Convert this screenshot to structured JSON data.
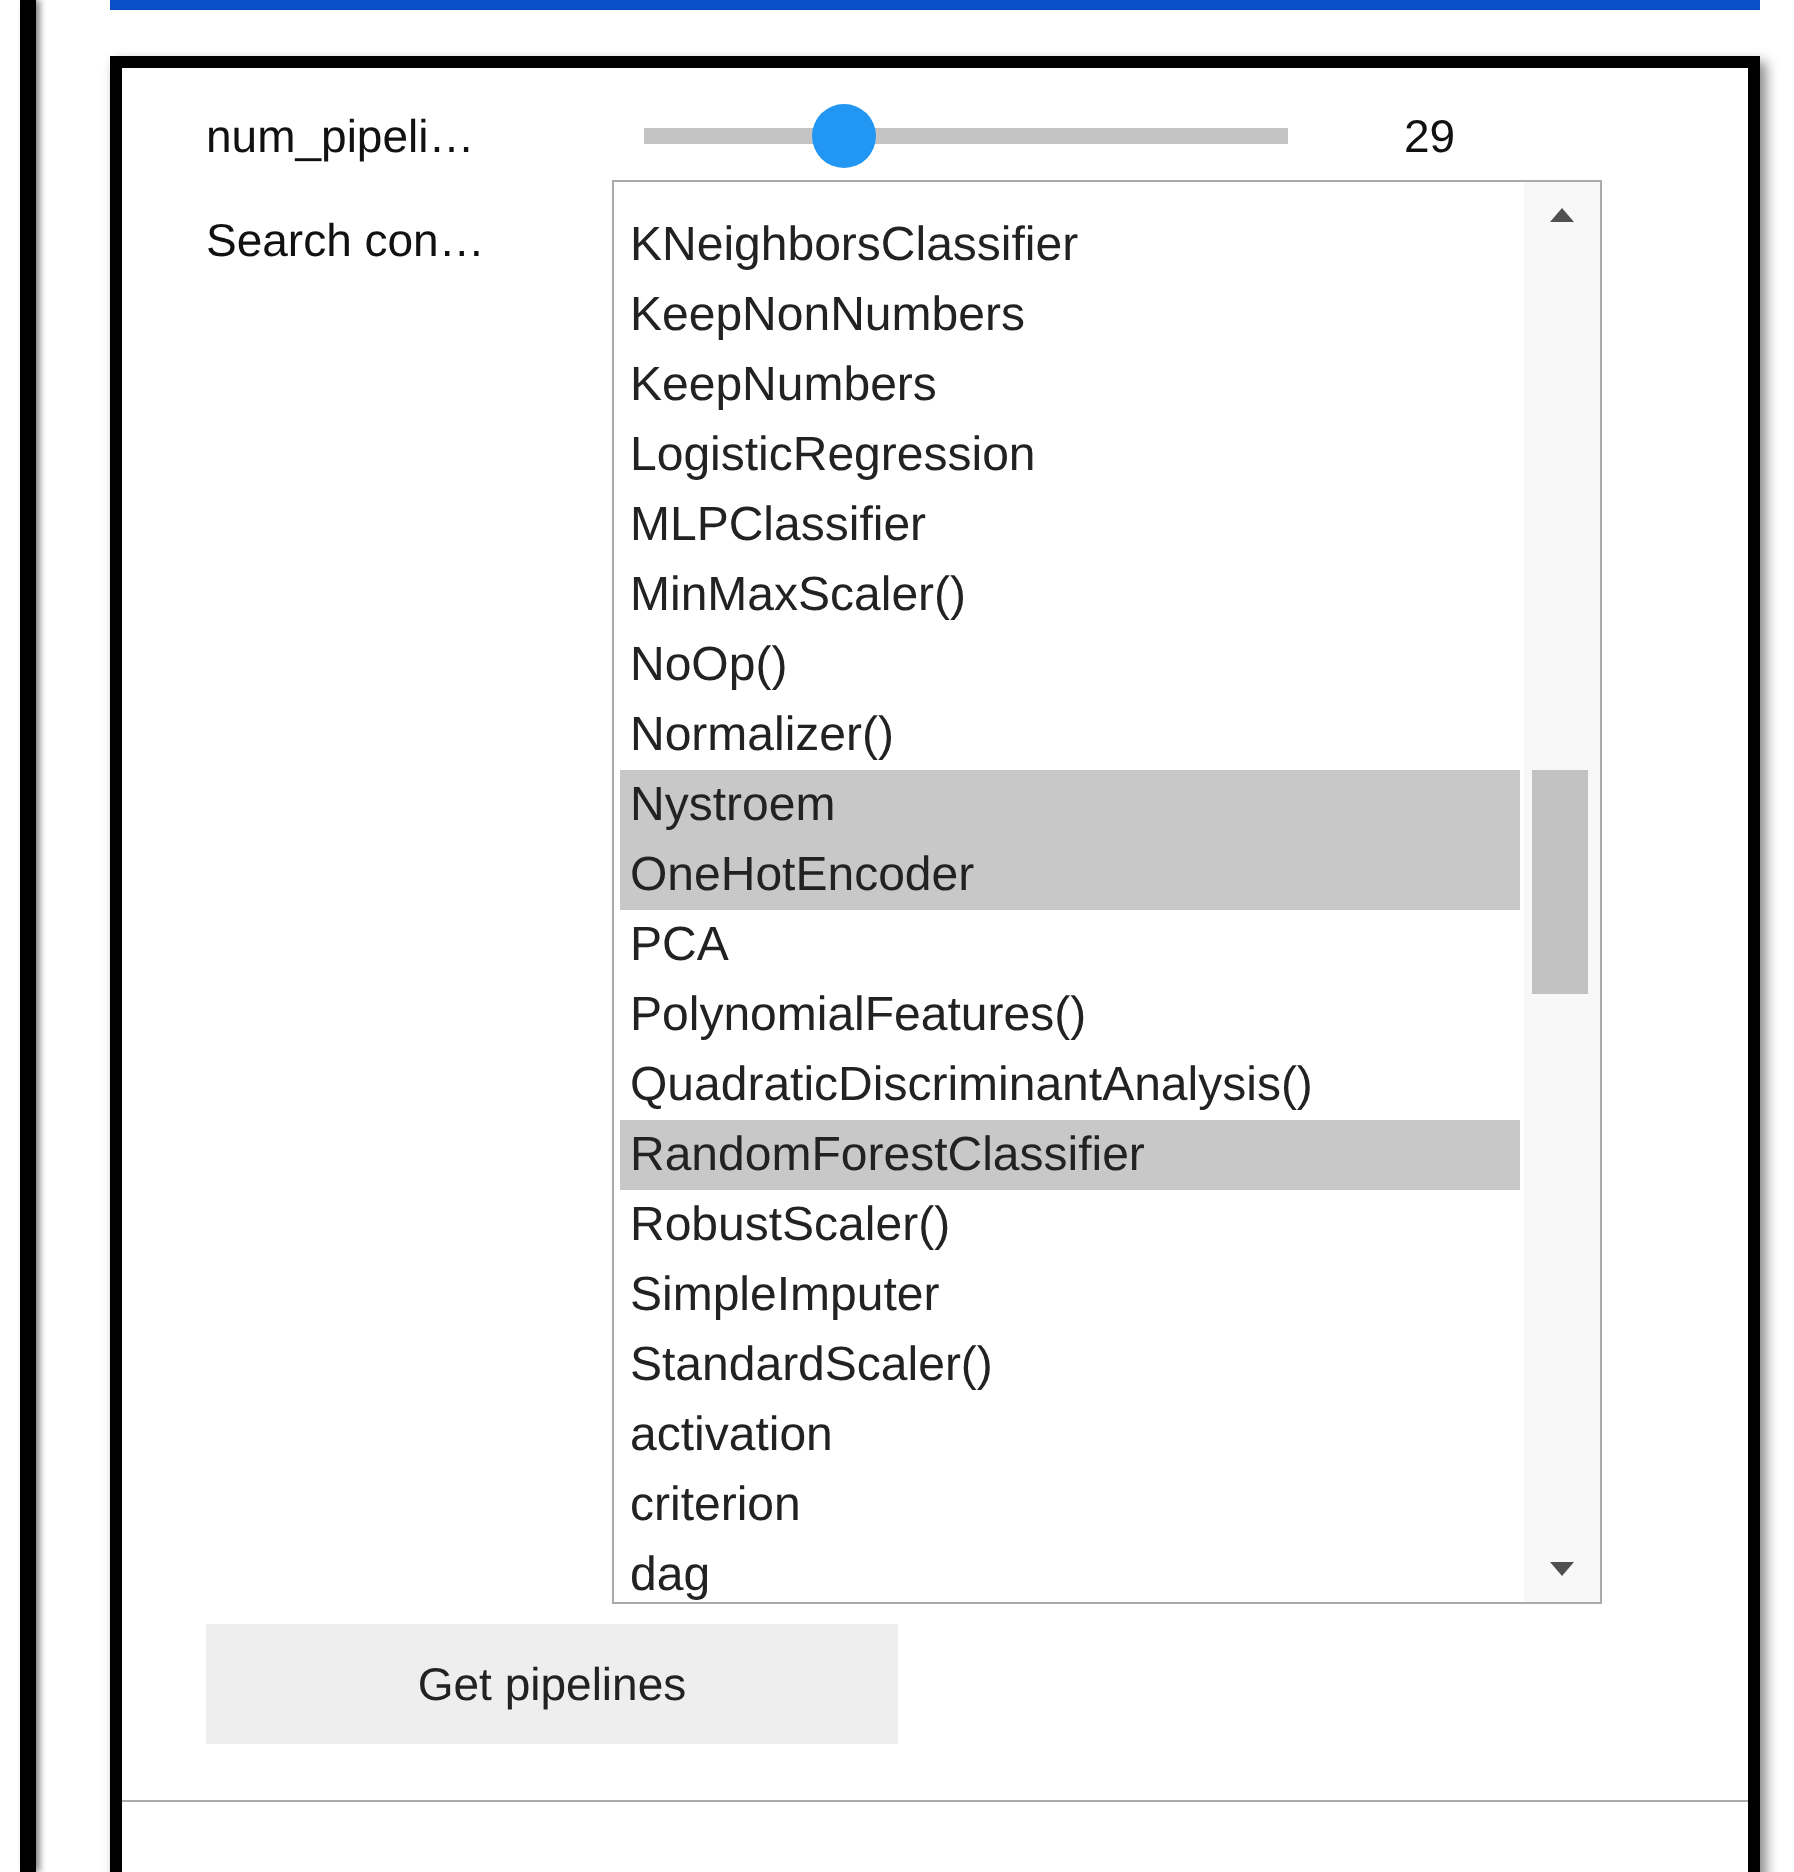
{
  "slider": {
    "label": "num_pipeli…",
    "level": 0.29,
    "reading": "29"
  },
  "search": {
    "label": "Search con…",
    "options": [
      {
        "text": "KNeighborsClassifier",
        "selected": false
      },
      {
        "text": "KeepNonNumbers",
        "selected": false
      },
      {
        "text": "KeepNumbers",
        "selected": false
      },
      {
        "text": "LogisticRegression",
        "selected": false
      },
      {
        "text": "MLPClassifier",
        "selected": false
      },
      {
        "text": "MinMaxScaler()",
        "selected": false
      },
      {
        "text": "NoOp()",
        "selected": false
      },
      {
        "text": "Normalizer()",
        "selected": false
      },
      {
        "text": "Nystroem",
        "selected": true
      },
      {
        "text": "OneHotEncoder",
        "selected": true
      },
      {
        "text": "PCA",
        "selected": false
      },
      {
        "text": "PolynomialFeatures()",
        "selected": false
      },
      {
        "text": "QuadraticDiscriminantAnalysis()",
        "selected": false
      },
      {
        "text": "RandomForestClassifier",
        "selected": true
      },
      {
        "text": "RobustScaler()",
        "selected": false
      },
      {
        "text": "SimpleImputer",
        "selected": false
      },
      {
        "text": "StandardScaler()",
        "selected": false
      },
      {
        "text": "activation",
        "selected": false
      },
      {
        "text": "criterion",
        "selected": false
      },
      {
        "text": "dag",
        "selected": false
      }
    ]
  },
  "button": "Get pipelines"
}
